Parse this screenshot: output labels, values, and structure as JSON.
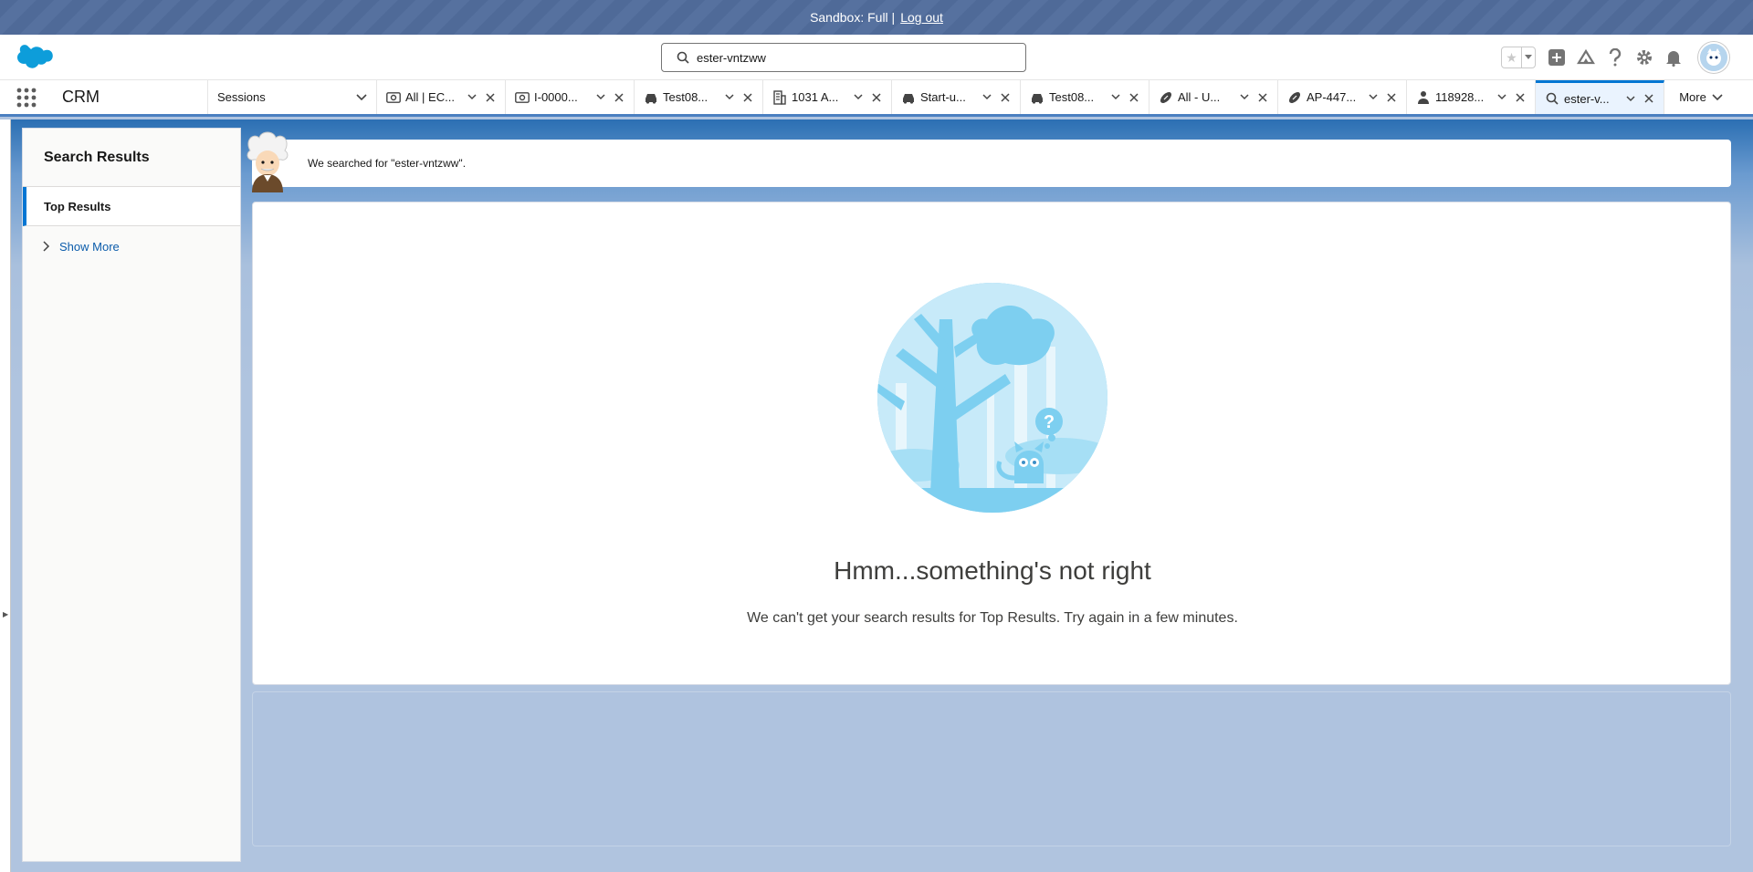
{
  "banner": {
    "text": "Sandbox: Full |",
    "logout": "Log out"
  },
  "header": {
    "search_value": "ester-vntzww",
    "icons": [
      "favorites-star-icon",
      "favorites-dropdown-icon",
      "global-actions-icon",
      "trailhead-icon",
      "help-icon",
      "setup-gear-icon",
      "notifications-bell-icon",
      "user-avatar"
    ]
  },
  "nav": {
    "app_name": "CRM",
    "sessions_label": "Sessions",
    "tabs": [
      {
        "label": "All | EC...",
        "icon": "camera-icon"
      },
      {
        "label": "I-0000...",
        "icon": "camera-icon"
      },
      {
        "label": "Test08...",
        "icon": "car-icon"
      },
      {
        "label": "1031 A...",
        "icon": "building-icon"
      },
      {
        "label": "Start-u...",
        "icon": "car-icon"
      },
      {
        "label": "Test08...",
        "icon": "car-icon"
      },
      {
        "label": "All - U...",
        "icon": "football-icon"
      },
      {
        "label": "AP-447...",
        "icon": "football-icon"
      },
      {
        "label": "118928...",
        "icon": "person-icon"
      },
      {
        "label": "ester-v...",
        "icon": "search-icon",
        "active": true
      }
    ],
    "more_label": "More"
  },
  "sidebar": {
    "title": "Search Results",
    "top_results": "Top Results",
    "show_more": "Show More"
  },
  "search_info": {
    "text": "We searched for \"ester-vntzww\"."
  },
  "main": {
    "error_title": "Hmm...something's not right",
    "error_message": "We can't get your search results for Top Results. Try again in a few minutes."
  },
  "colors": {
    "brand": "#0176d3",
    "link": "#0b5cab",
    "banner": "#4f6a98",
    "background": "#b0c4df"
  }
}
